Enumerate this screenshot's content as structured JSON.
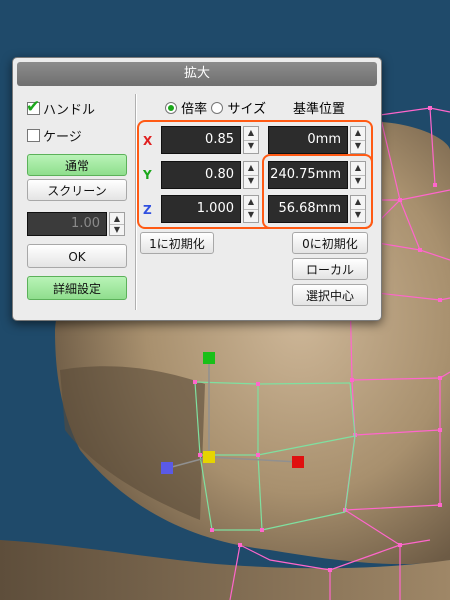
{
  "dialog": {
    "title": "拡大",
    "left": {
      "handle_label": "ハンドル",
      "handle_checked": true,
      "cage_label": "ケージ",
      "cage_checked": false,
      "normal_button": "通常",
      "screen_button": "スクリーン",
      "value_field": "1.00",
      "ok_button": "OK",
      "details_button": "詳細設定"
    },
    "right": {
      "mode_ratio_label": "倍率",
      "mode_size_label": "サイズ",
      "mode_selected": "倍率",
      "base_position_header": "基準位置",
      "axes": [
        {
          "label": "X",
          "scale": "0.85",
          "base": "0mm",
          "color": "#e02020"
        },
        {
          "label": "Y",
          "scale": "0.80",
          "base": "240.75mm",
          "color": "#1aa71a"
        },
        {
          "label": "Z",
          "scale": "1.000",
          "base": "56.68mm",
          "color": "#3050e0"
        }
      ],
      "reset1_button": "1に初期化",
      "reset0_button": "0に初期化",
      "local_button": "ローカル",
      "selection_center_button": "選択中心"
    }
  },
  "colors": {
    "accent_highlight": "#ff5a14",
    "mesh_line": "#ff66cc",
    "gizmo_line": "#7fe0a0"
  }
}
